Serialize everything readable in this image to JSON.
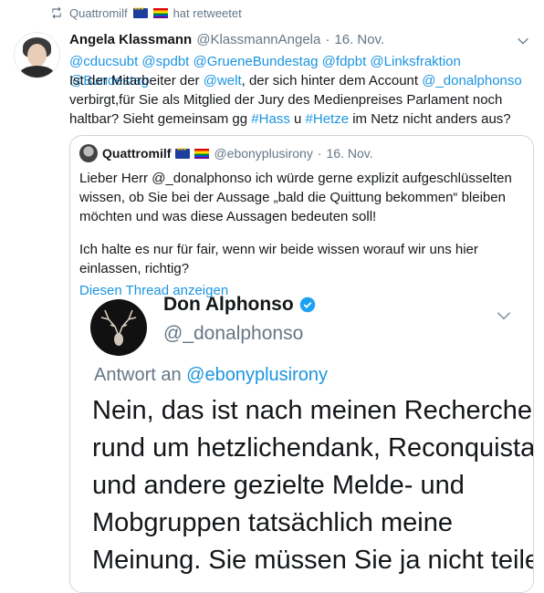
{
  "retweet": {
    "user": "Quattromilf",
    "suffix": "hat retweetet"
  },
  "tweet": {
    "name": "Angela Klassmann",
    "handle": "@KlassmannAngela",
    "separator": "·",
    "date": "16. Nov.",
    "mentions": "@cducsubt @spdbt @GrueneBundestag @fdpbt @Linksfraktion @Bundestag",
    "text_a": "Ist der Mitarbeiter der ",
    "mention_welt": "@welt",
    "text_b": ", der sich hinter dem Account ",
    "mention_don": "@_donalphonso",
    "text_c": "verbirgt,für Sie als Mitglied der Jury des Medienpreises Parlament noch",
    "text_d": "haltbar? Sieht gemeinsam gg ",
    "hashtag_hass": "#Hass",
    "text_e": " u ",
    "hashtag_hetze": "#Hetze",
    "text_f": " im Netz nicht anders aus?"
  },
  "quote": {
    "name": "Quattromilf",
    "handle": "@ebonyplusirony",
    "separator": "·",
    "date": "16. Nov.",
    "para1_l1": "Lieber Herr @_donalphonso ich würde gerne explizit aufgeschlüsselten",
    "para1_l2": "wissen, ob Sie bei der Aussage „bald die Quittung bekommen“ bleiben",
    "para1_l3": "möchten und was diese Aussagen bedeuten soll!",
    "para2_l1": "Ich halte es nur für fair, wenn wir beide wissen worauf wir uns hier",
    "para2_l2": "einlassen, richtig?",
    "thread_link": "Diesen Thread anzeigen"
  },
  "embedded": {
    "name": "Don Alphonso",
    "handle": "@_donalphonso",
    "reply_prefix": "Antwort an ",
    "reply_handle": "@ebonyplusirony",
    "line1": "Nein, das ist nach meinen Recherchen",
    "line2": "rund um hetzlichendank, Reconquista",
    "line3": "und andere gezielte Melde- und",
    "line4": "Mobgruppen tatsächlich meine",
    "line5": "Meinung. Sie müssen Sie ja nicht teilen"
  },
  "colors": {
    "link": "#1b95e0",
    "muted": "#657786",
    "text": "#14171a",
    "border": "#ccd6dd"
  },
  "icons": [
    "retweet-icon",
    "eu-flag-icon",
    "rainbow-flag-icon",
    "chevron-down-icon",
    "verified-badge-icon"
  ]
}
